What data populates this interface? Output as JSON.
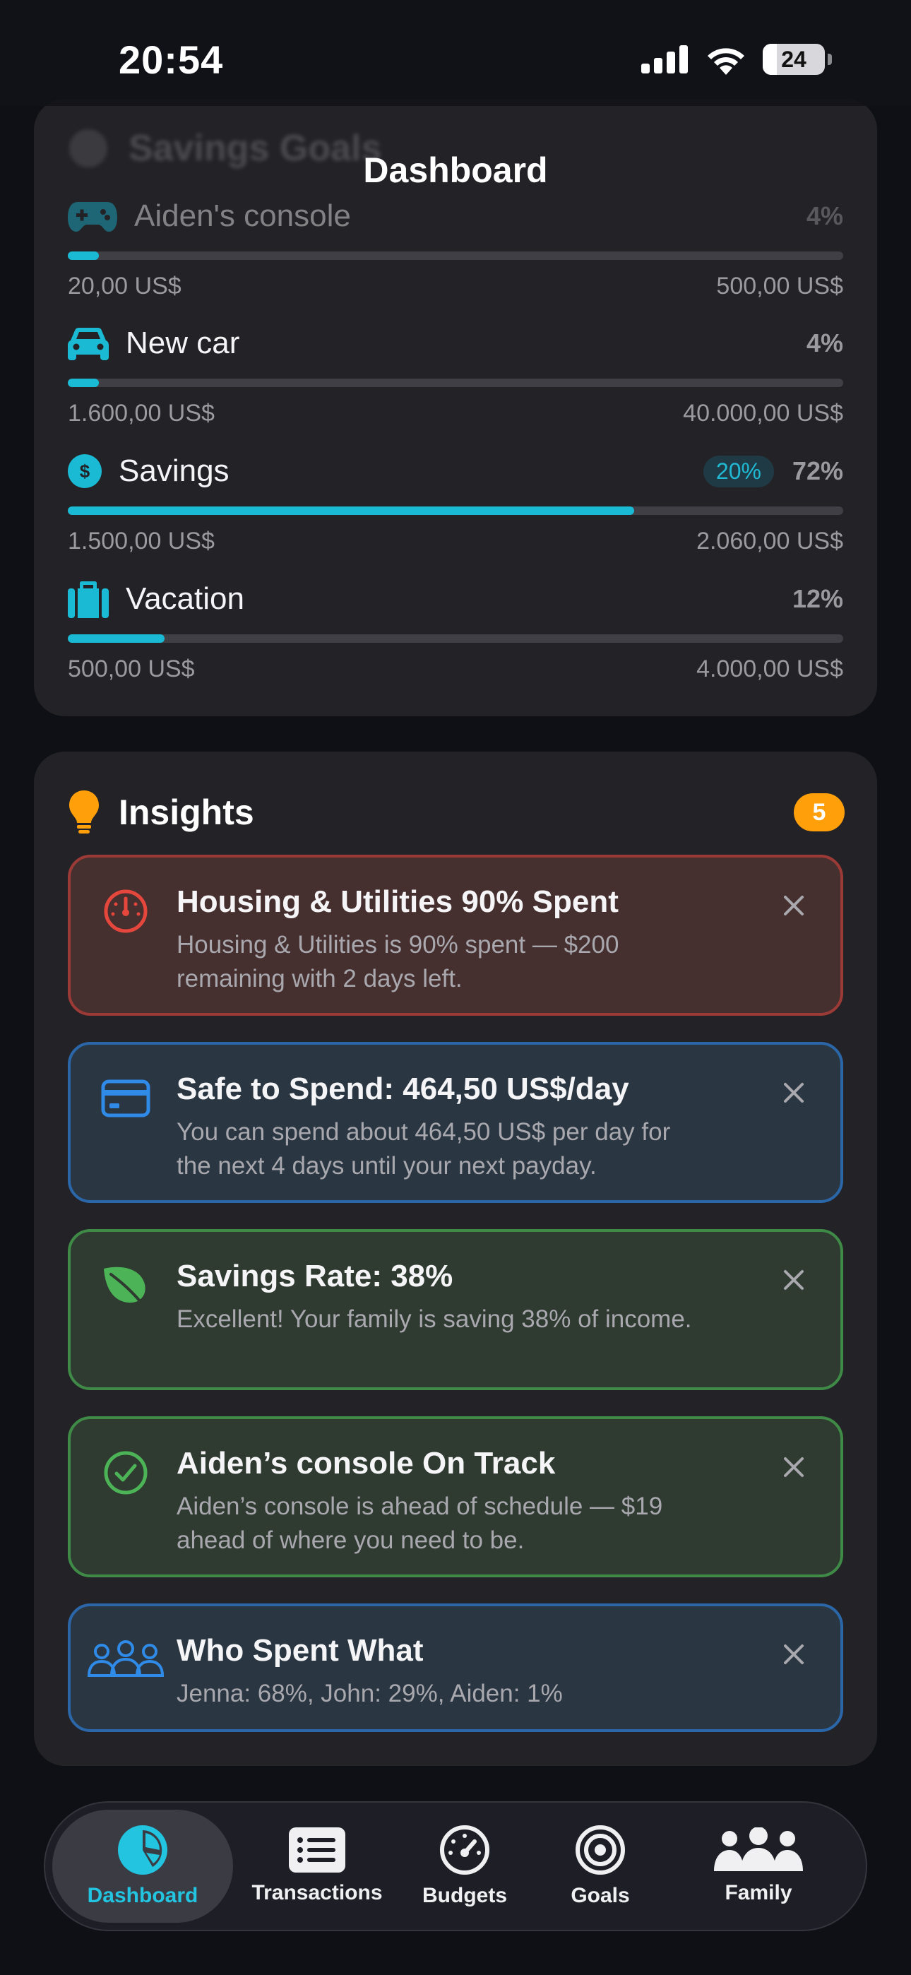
{
  "status_bar": {
    "time": "20:54",
    "battery": "24"
  },
  "header": {
    "title": "Dashboard"
  },
  "goals": {
    "faded_title": "Savings Goals",
    "items": [
      {
        "name": "Aiden's console",
        "percent": "4%",
        "progress": 0.04,
        "current": "20,00 US$",
        "target": "500,00 US$",
        "icon": "gamepad-icon"
      },
      {
        "name": "New car",
        "percent": "4%",
        "progress": 0.04,
        "current": "1.600,00 US$",
        "target": "40.000,00 US$",
        "icon": "car-icon"
      },
      {
        "name": "Savings",
        "chip": "20%",
        "percent": "72%",
        "progress": 0.73,
        "current": "1.500,00 US$",
        "target": "2.060,00 US$",
        "icon": "dollar-icon"
      },
      {
        "name": "Vacation",
        "percent": "12%",
        "progress": 0.125,
        "current": "500,00 US$",
        "target": "4.000,00 US$",
        "icon": "suitcase-icon"
      }
    ]
  },
  "insights": {
    "title": "Insights",
    "count": "5",
    "items": [
      {
        "title": "Housing & Utilities 90% Spent",
        "body": "Housing & Utilities is 90% spent — $200 remaining with 2 days left.",
        "icon": "speedometer-icon",
        "color": "#e5473d"
      },
      {
        "title": "Safe to Spend: 464,50 US$/day",
        "body": "You can spend about 464,50 US$ per day for the next 4 days until your next payday.",
        "icon": "credit-card-icon",
        "color": "#2f8ae8"
      },
      {
        "title": "Savings Rate: 38%",
        "body": "Excellent! Your family is saving 38% of income.",
        "icon": "leaf-icon",
        "color": "#4cb456"
      },
      {
        "title": "Aiden’s console On Track",
        "body": "Aiden’s console is ahead of schedule — $19 ahead of where you need to be.",
        "icon": "check-circle-icon",
        "color": "#4cb456"
      },
      {
        "title": "Who Spent What",
        "body": "Jenna: 68%, John: 29%, Aiden: 1%",
        "icon": "people-icon",
        "color": "#2f8ae8"
      }
    ]
  },
  "tabbar": {
    "tabs": [
      {
        "label": "Dashboard",
        "active": true
      },
      {
        "label": "Transactions"
      },
      {
        "label": "Budgets"
      },
      {
        "label": "Goals"
      },
      {
        "label": "Family"
      }
    ]
  }
}
